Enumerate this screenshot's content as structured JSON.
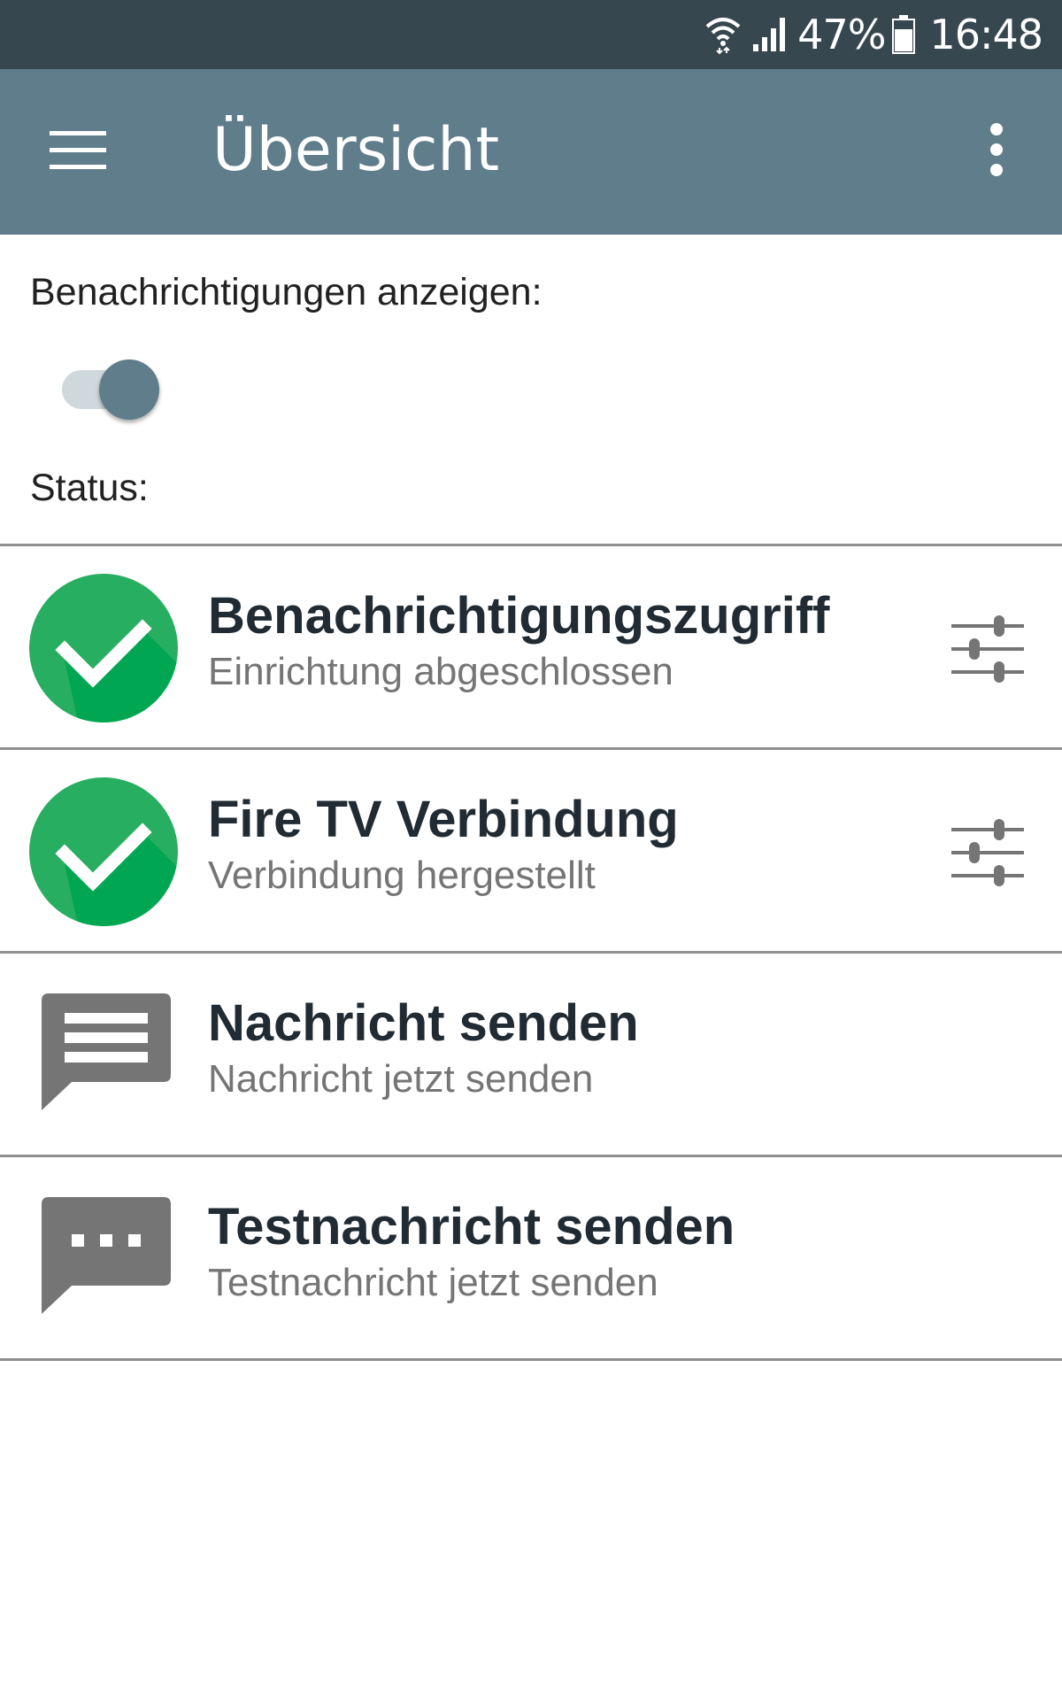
{
  "status_bar": {
    "battery_percent": "47%",
    "time": "16:48",
    "icons": [
      "wifi-icon",
      "signal-icon",
      "battery-icon"
    ]
  },
  "app_bar": {
    "title": "Übersicht",
    "icons": [
      "menu-icon",
      "more-vert-icon"
    ]
  },
  "settings": {
    "show_notifications_label": "Benachrichtigungen anzeigen:",
    "show_notifications_enabled": true,
    "status_label": "Status:"
  },
  "items": [
    {
      "title": "Benachrichtigungszugriff",
      "subtitle": "Einrichtung abgeschlossen",
      "icon": "check-circle-icon",
      "has_settings": true
    },
    {
      "title": "Fire TV Verbindung",
      "subtitle": "Verbindung hergestellt",
      "icon": "check-circle-icon",
      "has_settings": true
    },
    {
      "title": "Nachricht senden",
      "subtitle": "Nachricht jetzt senden",
      "icon": "message-icon",
      "has_settings": false
    },
    {
      "title": "Testnachricht senden",
      "subtitle": "Testnachricht jetzt senden",
      "icon": "chat-bubble-dots-icon",
      "has_settings": false
    }
  ],
  "colors": {
    "status_bar": "#37474f",
    "app_bar": "#607d8b",
    "check_green": "#27ae60",
    "check_green_dark": "#00a651",
    "message_icon_gray": "#757575",
    "title_text": "#212b33",
    "subtitle_text": "#757575"
  }
}
